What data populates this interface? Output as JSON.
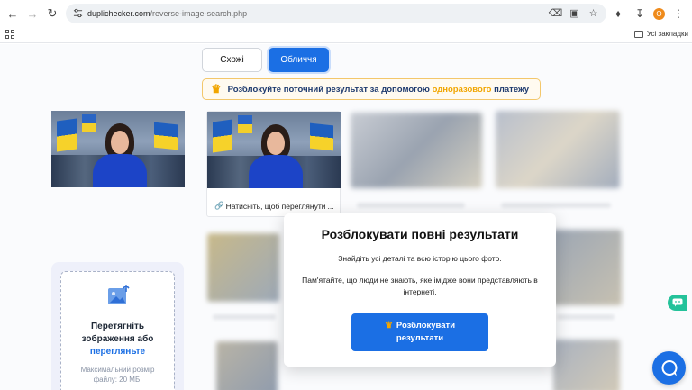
{
  "browser": {
    "url_host": "duplichecker.com",
    "url_path": "/reverse-image-search.php",
    "avatar_letter": "O",
    "bookmarks_label": "Усі закладки"
  },
  "tabs": {
    "similar": "Схожі",
    "faces": "Обличчя"
  },
  "banner": {
    "prefix": "Розблокуйте поточний результат за допомогою",
    "highlight": "одноразового",
    "suffix": "платежу"
  },
  "result": {
    "link_text": "Натисніть, щоб переглянути"
  },
  "upload": {
    "title_line1": "Перетягніть",
    "title_line2": "зображення або",
    "browse_link": "перегляньте",
    "hint_line1": "Максимальний розмір",
    "hint_line2": "файлу: 20 МБ."
  },
  "modal": {
    "title": "Розблокувати повні результати",
    "text1": "Знайдіть усі деталі та всю історію цього фото.",
    "text2": "Пам'ятайте, що люди не знають, яке імідже вони представляють в інтернеті.",
    "button_line1": "Розблокувати",
    "button_line2": "результати"
  },
  "colors": {
    "accent": "#1b6fe4",
    "crown": "#f1a500",
    "chat_side": "#24c29a"
  }
}
